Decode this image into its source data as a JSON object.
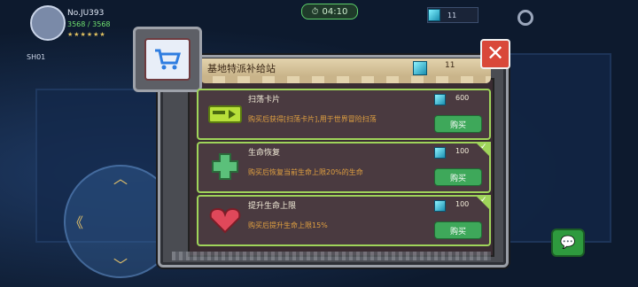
{
  "hud": {
    "player_name": "No.JU393",
    "hp": "3568 / 3568",
    "timer": "04:10",
    "top_gem_value": "11",
    "side_label": "SH01"
  },
  "shop": {
    "title": "基地特派补给站",
    "gem_value": "11",
    "items": [
      {
        "name": "扫荡卡片",
        "desc": "购买后获得[扫荡卡片],用于世界冒险扫荡",
        "price": "600",
        "buy_label": "购买",
        "icon": "pass-card-icon"
      },
      {
        "name": "生命恢复",
        "desc": "购买后恢复当前生命上限20%的生命",
        "price": "100",
        "buy_label": "购买",
        "icon": "health-cross-icon"
      },
      {
        "name": "提升生命上限",
        "desc": "购买后提升生命上限15%",
        "price": "100",
        "buy_label": "购买",
        "icon": "heart-icon"
      }
    ]
  },
  "colors": {
    "accent_green": "#9fd45a",
    "buy_green": "#3ea85a",
    "close_red": "#d9483a",
    "desc_orange": "#e0a040"
  }
}
